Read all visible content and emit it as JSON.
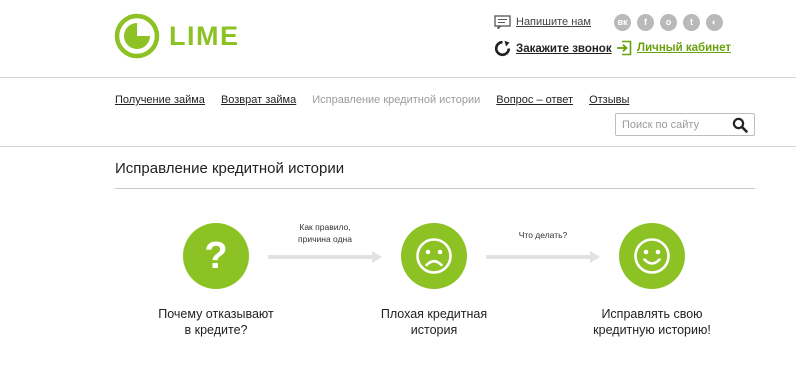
{
  "brand": {
    "name": "LIME",
    "accent": "#8cc224",
    "link_green": "#6aa20f"
  },
  "header": {
    "write_us": "Напишите нам",
    "order_call": "Закажите звонок",
    "personal_cabinet": "Личный кабинет",
    "social": [
      {
        "name": "vk-icon",
        "glyph": "вк"
      },
      {
        "name": "facebook-icon",
        "glyph": "f"
      },
      {
        "name": "odnoklassniki-icon",
        "glyph": "о"
      },
      {
        "name": "twitter-icon",
        "glyph": "t"
      },
      {
        "name": "other-social-icon",
        "glyph": "◐"
      }
    ]
  },
  "nav": {
    "items": [
      {
        "label": "Получение займа",
        "active": false
      },
      {
        "label": "Возврат займа",
        "active": false
      },
      {
        "label": "Исправление кредитной истории",
        "active": true
      },
      {
        "label": "Вопрос – ответ",
        "active": false
      },
      {
        "label": "Отзывы",
        "active": false
      }
    ]
  },
  "search": {
    "placeholder": "Поиск по сайту",
    "icon": "search-icon"
  },
  "main": {
    "title": "Исправление кредитной истории",
    "steps": [
      {
        "line1": "Почему отказывают",
        "line2": "в кредите?",
        "icon": "question-icon"
      },
      {
        "line1": "Плохая кредитная",
        "line2": "история",
        "icon": "sad-face-icon"
      },
      {
        "line1": "Исправлять свою",
        "line2": "кредитную историю!",
        "icon": "happy-face-icon"
      }
    ],
    "arrows": [
      {
        "line1": "Как правило,",
        "line2": "причина одна"
      },
      {
        "line1": "Что делать?",
        "line2": ""
      }
    ]
  }
}
